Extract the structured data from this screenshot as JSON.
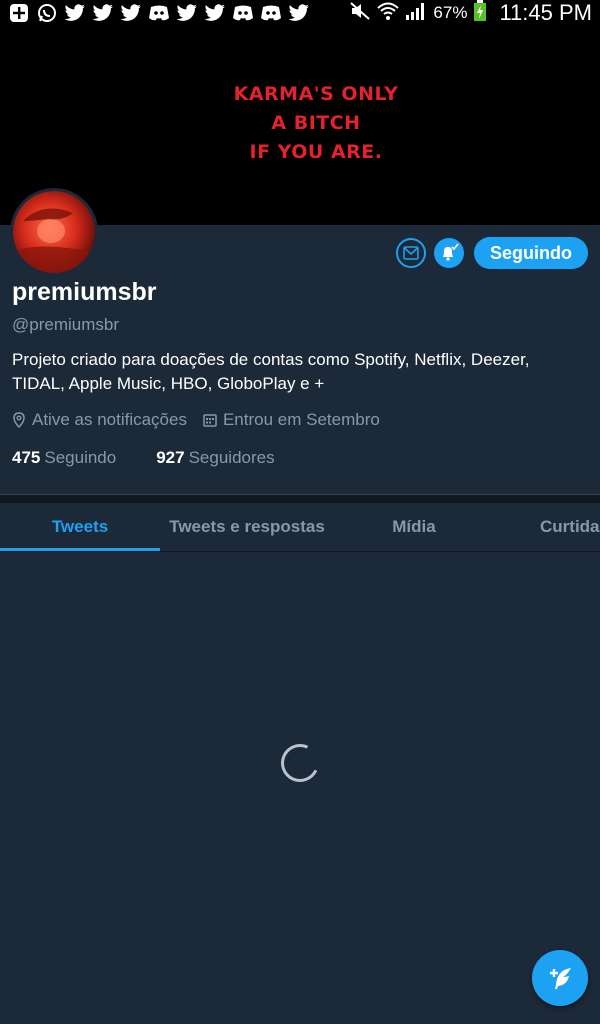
{
  "status_bar": {
    "battery": "67%",
    "time": "11:45 PM",
    "notification_icons": [
      "add-icon",
      "whatsapp-icon",
      "twitter-icon",
      "twitter-icon",
      "twitter-icon",
      "discord-icon",
      "twitter-icon",
      "twitter-icon",
      "discord-icon",
      "discord-icon",
      "twitter-icon"
    ]
  },
  "banner": {
    "line1": "KARMA'S ONLY",
    "line2": "A BITCH",
    "line3": "IF YOU ARE."
  },
  "profile": {
    "name": "premiumsbr",
    "handle": "@premiumsbr",
    "bio": "Projeto criado para doações de contas como Spotify, Netflix, Deezer, TIDAL, Apple Music, HBO, GloboPlay e +",
    "location": "Ative as notificações",
    "joined": "Entrou em Setembro",
    "following_count": "475",
    "following_label": "Seguindo",
    "followers_count": "927",
    "followers_label": "Seguidores"
  },
  "actions": {
    "follow_label": "Seguindo"
  },
  "tabs": [
    {
      "label": "Tweets",
      "active": true
    },
    {
      "label": "Tweets e respostas",
      "active": false
    },
    {
      "label": "Mídia",
      "active": false
    },
    {
      "label": "Curtidas",
      "active": false
    }
  ],
  "colors": {
    "accent": "#1da1f2",
    "background": "#1c2938",
    "muted": "#8899a6",
    "banner_text": "#e3222e"
  }
}
